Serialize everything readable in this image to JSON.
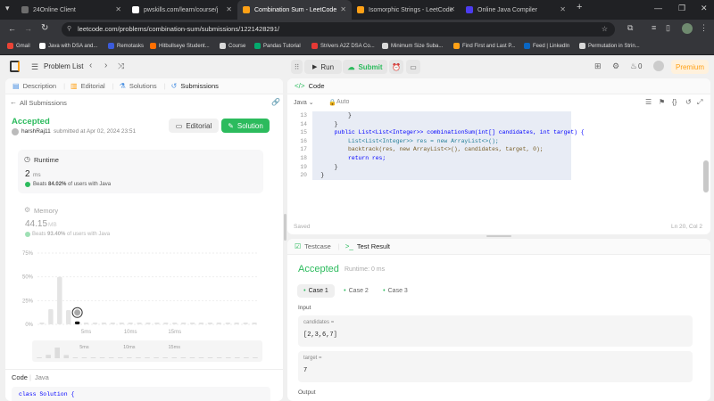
{
  "browser": {
    "tabs": [
      {
        "label": "24Online Client",
        "icon_color": "#6d6d6d"
      },
      {
        "label": "pwskills.com/learn/course/j",
        "icon_color": "#ffffff"
      },
      {
        "label": "Combination Sum - LeetCode",
        "icon_color": "#ffa116"
      },
      {
        "label": "Isomorphic Strings - LeetCode",
        "icon_color": "#ffa116"
      },
      {
        "label": "Online Java Compiler",
        "icon_color": "#4c3cf0"
      }
    ],
    "new_tab": "+",
    "url": "leetcode.com/problems/combination-sum/submissions/1221428291/",
    "bookmarks": [
      {
        "label": "Gmail",
        "color": "#ea4335"
      },
      {
        "label": "Java with DSA and...",
        "color": "#ffffff"
      },
      {
        "label": "Remotasks",
        "color": "#3b5bdb"
      },
      {
        "label": "Hitbullseye Student...",
        "color": "#ff6f00"
      },
      {
        "label": "Course",
        "color": "#d9d9d9"
      },
      {
        "label": "Pandas Tutorial",
        "color": "#04aa6d"
      },
      {
        "label": "Strivers A2Z DSA Co...",
        "color": "#e53935"
      },
      {
        "label": "Minimum Size Suba...",
        "color": "#d9d9d9"
      },
      {
        "label": "Find First and Last P...",
        "color": "#ffa116"
      },
      {
        "label": "Feed | LinkedIn",
        "color": "#0a66c2"
      },
      {
        "label": "Permutation in Strin...",
        "color": "#d9d9d9"
      }
    ]
  },
  "lc": {
    "problem_list": "Problem List",
    "run": "Run",
    "submit": "Submit",
    "coins": "0",
    "premium": "Premium",
    "colors": {
      "green": "#2cbb5d",
      "orange": "#ffa116"
    }
  },
  "left": {
    "tabs": [
      "Description",
      "Editorial",
      "Solutions",
      "Submissions"
    ],
    "all_submissions": "All Submissions",
    "status": "Accepted",
    "user": "harshRaj11",
    "submitted": "submitted at Apr 02, 2024 23:51",
    "editorial_btn": "Editorial",
    "solution_btn": "Solution",
    "runtime_label": "Runtime",
    "runtime_value": "2",
    "runtime_unit": "ms",
    "runtime_beats_prefix": "Beats",
    "runtime_beats_pct": "84.02%",
    "runtime_beats_suffix": "of users with Java",
    "memory_label": "Memory",
    "memory_value": "44.15",
    "memory_unit": "MB",
    "memory_beats_prefix": "Beats",
    "memory_beats_pct": "93.40%",
    "memory_beats_suffix": "of users with Java",
    "code_tab": "Code",
    "code_lang": "Java",
    "code_preview": "class Solution {"
  },
  "chart_data": {
    "type": "bar",
    "title": "",
    "ylim": [
      0,
      75
    ],
    "yticks": [
      "75%",
      "50%",
      "25%",
      "0%"
    ],
    "xticks": [
      "5ms",
      "10ms",
      "15ms"
    ],
    "selected_index": 4,
    "values": [
      2,
      16,
      50,
      15,
      3,
      2,
      2,
      2,
      2,
      2,
      2,
      2,
      2,
      2,
      2,
      2,
      2,
      2,
      2,
      2,
      2,
      2,
      2,
      2,
      2
    ],
    "mini_xticks": [
      "5ms",
      "10ms",
      "15ms"
    ]
  },
  "editor": {
    "title": "Code",
    "lang": "Java",
    "mode": "Auto",
    "saved": "Saved",
    "cursor": "Ln 20, Col 2",
    "lines": [
      {
        "n": "13",
        "text": "        }"
      },
      {
        "n": "14",
        "text": "    }"
      },
      {
        "n": "15",
        "text": "    public List<List<Integer>> combinationSum(int[] candidates, int target) {"
      },
      {
        "n": "16",
        "text": "        List<List<Integer>> res = new ArrayList<>();"
      },
      {
        "n": "17",
        "text": "        backtrack(res, new ArrayList<>(), candidates, target, 0);"
      },
      {
        "n": "18",
        "text": "        return res;"
      },
      {
        "n": "19",
        "text": "    }"
      },
      {
        "n": "20",
        "text": "}"
      }
    ]
  },
  "result": {
    "tab_testcase": "Testcase",
    "tab_result": "Test Result",
    "status": "Accepted",
    "runtime": "Runtime: 0 ms",
    "cases": [
      "Case 1",
      "Case 2",
      "Case 3"
    ],
    "input_label": "Input",
    "params": [
      {
        "name": "candidates =",
        "value": "[2,3,6,7]"
      },
      {
        "name": "target =",
        "value": "7"
      }
    ],
    "output_label": "Output"
  }
}
